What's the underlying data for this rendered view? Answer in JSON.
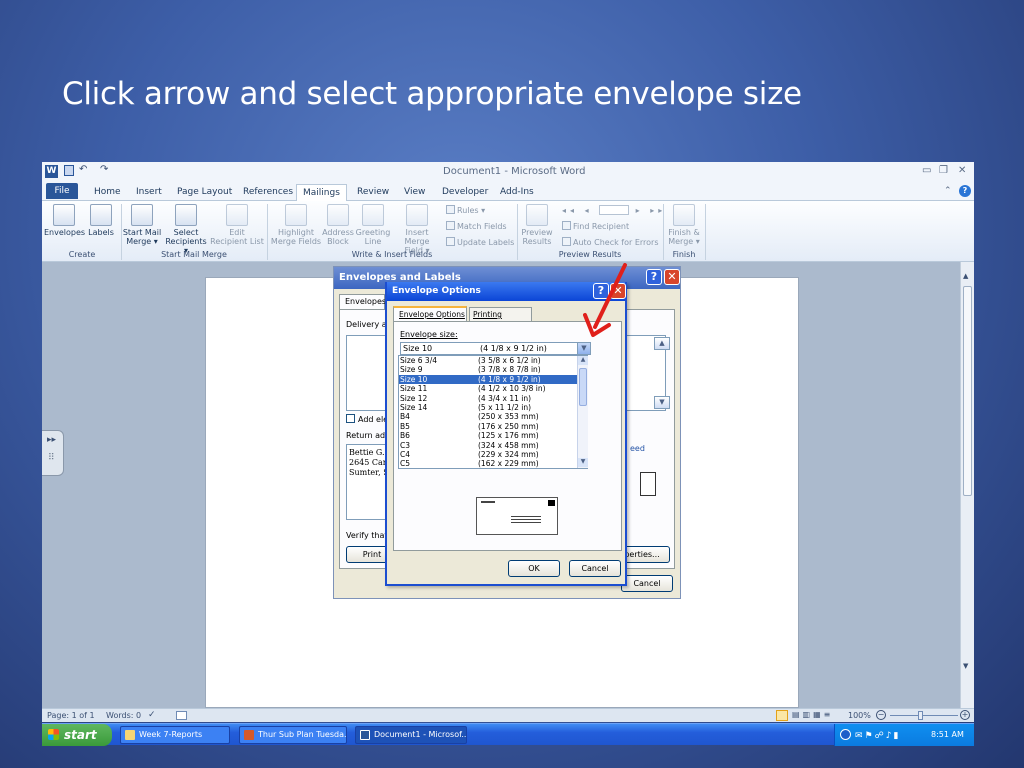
{
  "slide": {
    "title": "Click arrow and select appropriate envelope size"
  },
  "window": {
    "title": "Document1 - Microsoft Word"
  },
  "tabs": [
    "File",
    "Home",
    "Insert",
    "Page Layout",
    "References",
    "Mailings",
    "Review",
    "View",
    "Developer",
    "Add-Ins"
  ],
  "active_tab": "Mailings",
  "ribbon": {
    "envelopes": "Envelopes",
    "labels": "Labels",
    "start_mail_merge": "Start Mail",
    "start_mail_merge_2": "Merge ▾",
    "select_recipients": "Select",
    "select_recipients_2": "Recipients ▾",
    "edit_recipient_list": "Edit",
    "edit_recipient_list_2": "Recipient List",
    "highlight_merge_fields": "Highlight",
    "highlight_merge_fields_2": "Merge Fields",
    "address_block": "Address",
    "address_block_2": "Block",
    "greeting_line": "Greeting",
    "greeting_line_2": "Line",
    "insert_merge_field": "Insert Merge",
    "insert_merge_field_2": "Field ▾",
    "rules": "Rules ▾",
    "match_fields": "Match Fields",
    "update_labels": "Update Labels",
    "preview_results": "Preview",
    "preview_results_2": "Results",
    "find_recipient": "Find Recipient",
    "auto_check": "Auto Check for Errors",
    "finish_merge": "Finish &",
    "finish_merge_2": "Merge ▾",
    "groups": {
      "create": "Create",
      "start_mail_merge": "Start Mail Merge",
      "write_insert": "Write & Insert Fields",
      "preview": "Preview Results",
      "finish": "Finish"
    }
  },
  "env_dialog": {
    "title": "Envelopes and Labels",
    "tab": "Envelopes",
    "delivery_label": "Delivery ad",
    "add_electronic": "Add ele",
    "return_label": "Return add",
    "return_lines": [
      "Bettie G.",
      "2645 Car",
      "Sumter, S"
    ],
    "feed_label": "eed",
    "verify": "Verify that",
    "print_btn": "Print",
    "properties_btn": "perties...",
    "cancel_btn": "Cancel"
  },
  "opt_dialog": {
    "title": "Envelope Options",
    "tab_options": "Envelope Options",
    "tab_printing": "Printing Options",
    "size_label": "Envelope size:",
    "selected_name": "Size 10",
    "selected_dims": "(4 1/8 x 9 1/2 in)",
    "ok_btn": "OK",
    "cancel_btn": "Cancel",
    "sizes": [
      {
        "name": "Size 6 3/4",
        "dims": "(3 5/8 x 6 1/2 in)"
      },
      {
        "name": "Size 9",
        "dims": "(3 7/8 x 8 7/8 in)"
      },
      {
        "name": "Size 10",
        "dims": "(4 1/8 x 9 1/2 in)",
        "selected": true
      },
      {
        "name": "Size 11",
        "dims": "(4 1/2 x 10 3/8 in)"
      },
      {
        "name": "Size 12",
        "dims": "(4 3/4 x 11 in)"
      },
      {
        "name": "Size 14",
        "dims": "(5 x 11 1/2 in)"
      },
      {
        "name": "B4",
        "dims": "(250 x 353 mm)"
      },
      {
        "name": "B5",
        "dims": "(176 x 250 mm)"
      },
      {
        "name": "B6",
        "dims": "(125 x 176 mm)"
      },
      {
        "name": "C3",
        "dims": "(324 x 458 mm)"
      },
      {
        "name": "C4",
        "dims": "(229 x 324 mm)"
      },
      {
        "name": "C5",
        "dims": "(162 x 229 mm)"
      }
    ]
  },
  "status": {
    "page": "Page: 1 of 1",
    "words": "Words: 0",
    "zoom": "100%"
  },
  "taskbar": {
    "start": "start",
    "items": [
      "Week 7-Reports",
      "Thur Sub Plan Tuesda...",
      "Document1 - Microsof..."
    ],
    "clock": "8:51 AM"
  },
  "colors": {
    "accent_arrow": "#e0201b",
    "title_bar": "#0b45d6",
    "selection": "#316ac5"
  }
}
